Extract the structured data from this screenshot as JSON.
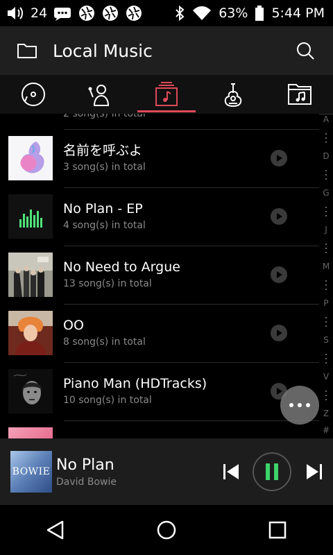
{
  "status_bar": {
    "notification_count": "24",
    "battery": "63%",
    "time": "5:44 PM"
  },
  "app_bar": {
    "title": "Local Music",
    "icons": [
      "folder-icon",
      "search-icon"
    ]
  },
  "tabs": [
    {
      "icon": "disc-icon",
      "active": false
    },
    {
      "icon": "artist-icon",
      "active": false
    },
    {
      "icon": "album-music-icon",
      "active": true
    },
    {
      "icon": "guitar-icon",
      "active": false
    },
    {
      "icon": "music-folder-icon",
      "active": false
    }
  ],
  "accent_color": "#e04a59",
  "albums": {
    "partial_top_subtitle": "2 song(s) in total",
    "items": [
      {
        "name": "名前を呼ぶよ",
        "subtitle": "3 song(s) in total"
      },
      {
        "name": "No Plan - EP",
        "subtitle": "4 song(s) in total"
      },
      {
        "name": "No Need to Argue",
        "subtitle": "13 song(s) in total"
      },
      {
        "name": "OO",
        "subtitle": "8 song(s) in total"
      },
      {
        "name": "Piano Man (HDTracks)",
        "subtitle": "10 song(s) in total"
      }
    ]
  },
  "alphabet_index": [
    "A",
    "D",
    "G",
    "J",
    "M",
    "P",
    "S",
    "V",
    "Z",
    "#"
  ],
  "now_playing": {
    "title": "No Plan",
    "artist": "David Bowie",
    "cover_text": "BOWIE",
    "state": "playing"
  }
}
